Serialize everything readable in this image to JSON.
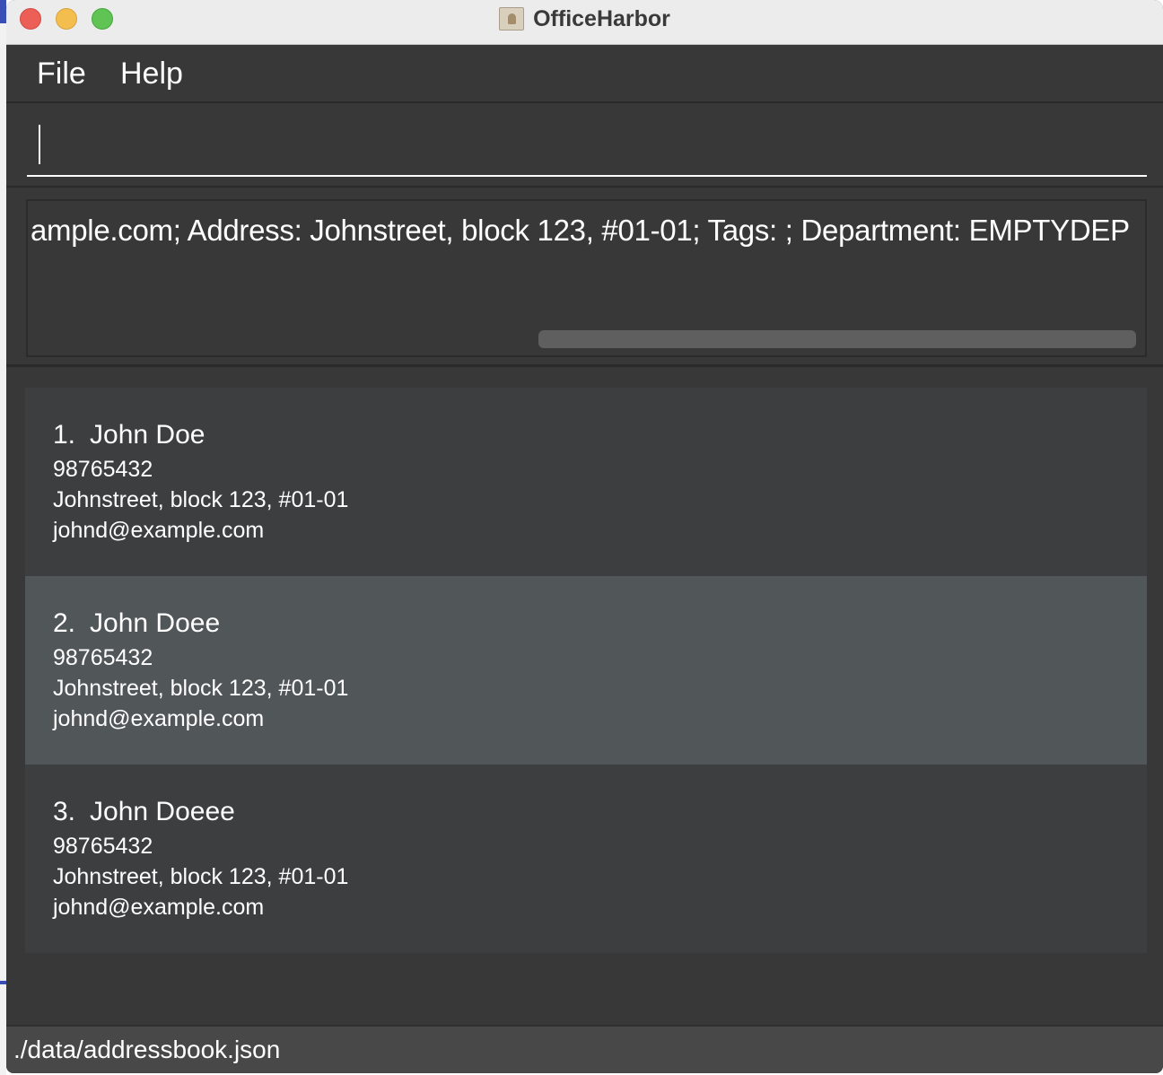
{
  "window": {
    "title": "OfficeHarbor"
  },
  "menu": {
    "items": [
      "File",
      "Help"
    ]
  },
  "command": {
    "value": "",
    "placeholder": ""
  },
  "result": {
    "text": "ample.com; Address: Johnstreet, block 123, #01-01; Tags: ; Department: EMPTYDEP"
  },
  "persons": [
    {
      "index": "1.",
      "name": "John Doe",
      "phone": "98765432",
      "address": "Johnstreet, block 123, #01-01",
      "email": "johnd@example.com",
      "selected": false
    },
    {
      "index": "2.",
      "name": "John Doee",
      "phone": "98765432",
      "address": "Johnstreet, block 123, #01-01",
      "email": "johnd@example.com",
      "selected": true
    },
    {
      "index": "3.",
      "name": "John Doeee",
      "phone": "98765432",
      "address": "Johnstreet, block 123, #01-01",
      "email": "johnd@example.com",
      "selected": false
    }
  ],
  "status": {
    "path": "./data/addressbook.json"
  },
  "colors": {
    "background": "#383838",
    "card": "#3c3e3f",
    "card_selected": "#515658",
    "text": "#ffffff"
  }
}
